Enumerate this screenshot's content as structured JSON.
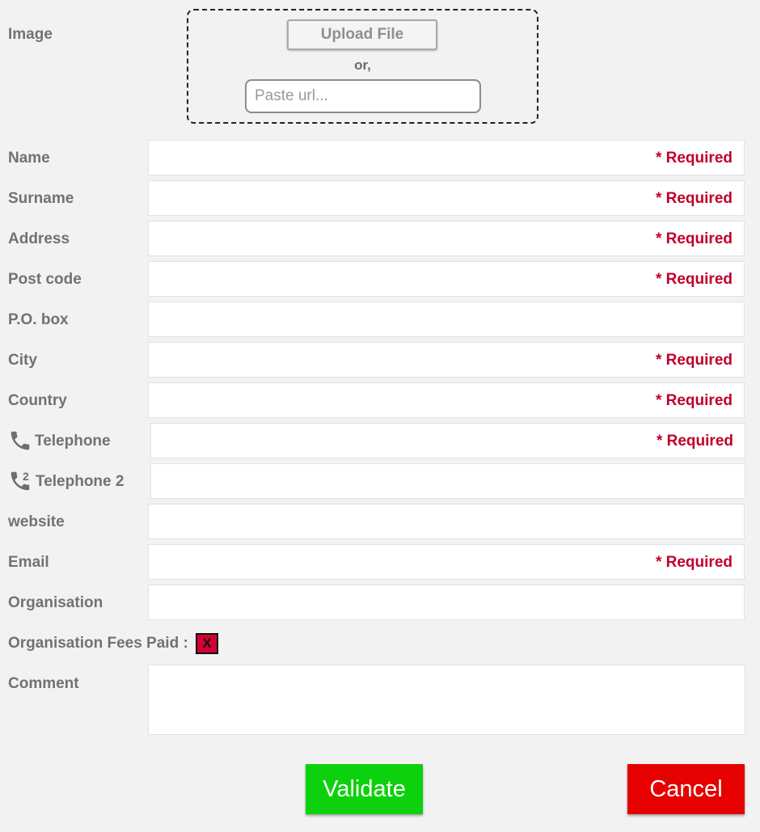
{
  "image": {
    "label": "Image",
    "upload_label": "Upload File",
    "or_text": "or,",
    "url_placeholder": "Paste url..."
  },
  "required_text": "* Required",
  "fields": [
    {
      "label": "Name",
      "required": true
    },
    {
      "label": "Surname",
      "required": true
    },
    {
      "label": "Address",
      "required": true
    },
    {
      "label": "Post code",
      "required": true
    },
    {
      "label": "P.O. box",
      "required": false
    },
    {
      "label": "City",
      "required": true
    },
    {
      "label": "Country",
      "required": true
    },
    {
      "label": "Telephone",
      "required": true,
      "icon": "phone-icon"
    },
    {
      "label": "Telephone 2",
      "required": false,
      "icon": "phone-2-icon",
      "icon_sup": "2"
    },
    {
      "label": "website",
      "required": false
    },
    {
      "label": "Email",
      "required": true
    },
    {
      "label": "Organisation",
      "required": false
    }
  ],
  "fees": {
    "label": "Organisation Fees Paid :",
    "mark": "X",
    "paid": false
  },
  "comment": {
    "label": "Comment"
  },
  "buttons": {
    "validate": "Validate",
    "cancel": "Cancel"
  },
  "colors": {
    "required": "#c0002a",
    "validate": "#0cd10c",
    "cancel": "#e60000",
    "fees_unpaid": "#d40032"
  }
}
